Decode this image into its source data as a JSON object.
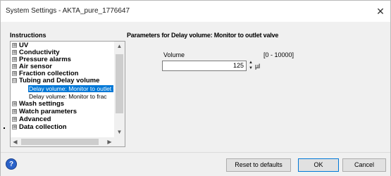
{
  "window": {
    "title": "System Settings - AKTA_pure_1776647",
    "close_glyph": "✕"
  },
  "instructions": {
    "heading": "Instructions",
    "tree": [
      {
        "label": "UV",
        "expander": "⊞"
      },
      {
        "label": "Conductivity",
        "expander": "⊞"
      },
      {
        "label": "Pressure alarms",
        "expander": "⊞"
      },
      {
        "label": "Air sensor",
        "expander": "⊞"
      },
      {
        "label": "Fraction collection",
        "expander": "⊞"
      },
      {
        "label": "Tubing and Delay volume",
        "expander": "⊟",
        "children": [
          {
            "label": "Delay volume: Monitor to outlet valve",
            "selected": true
          },
          {
            "label": "Delay volume: Monitor to frac",
            "selected": false
          }
        ]
      },
      {
        "label": "Wash settings",
        "expander": "⊞"
      },
      {
        "label": "Watch parameters",
        "expander": "⊞"
      },
      {
        "label": "Advanced",
        "expander": "⊞"
      },
      {
        "label": "Data collection",
        "expander": "⊞"
      }
    ]
  },
  "parameters": {
    "heading": "Parameters for Delay volume: Monitor to outlet valve",
    "volume_label": "Volume",
    "range": "[0 - 10000]",
    "value": "125",
    "unit": "µl"
  },
  "buttons": {
    "help": "?",
    "reset": "Reset to defaults",
    "ok": "OK",
    "cancel": "Cancel"
  },
  "icons": {
    "help": "help-icon",
    "close": "close-icon",
    "scroll_up": "chevron-up-icon",
    "scroll_down": "chevron-down-icon",
    "scroll_left": "chevron-left-icon",
    "scroll_right": "chevron-right-icon"
  },
  "colors": {
    "selection": "#0078d7",
    "help_icon": "#2a62c9"
  }
}
